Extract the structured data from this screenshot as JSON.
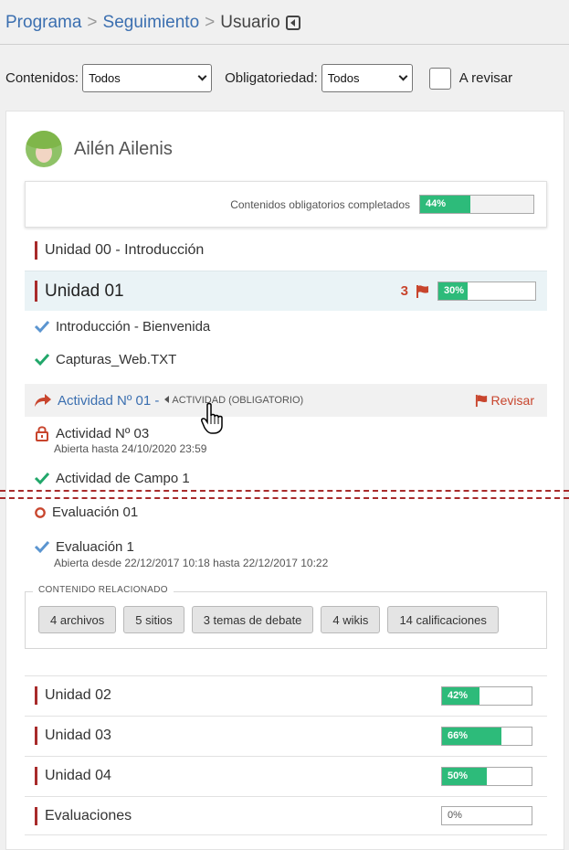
{
  "breadcrumb": {
    "item1": "Programa",
    "sep1": ">",
    "item2": "Seguimiento",
    "sep2": ">",
    "current": "Usuario"
  },
  "filters": {
    "contenidos_label": "Contenidos:",
    "contenidos_value": "Todos",
    "obligatoriedad_label": "Obligatoriedad:",
    "obligatoriedad_value": "Todos",
    "revisar_label": "A revisar"
  },
  "user": {
    "name": "Ailén Ailenis"
  },
  "summary": {
    "label": "Contenidos obligatorios completados",
    "percent_text": "44%",
    "percent": 44
  },
  "units": {
    "u00": {
      "title": "Unidad 00 - Introducción"
    },
    "u01": {
      "title": "Unidad 01",
      "flag_count": "3",
      "percent_text": "30%",
      "percent": 30
    }
  },
  "items": {
    "intro": "Introducción - Bienvenida",
    "capturas": "Capturas_Web.TXT",
    "actividad01": "Actividad Nº 01 -",
    "actividad01_tag": "ACTIVIDAD (OBLIGATORIO)",
    "revisar": "Revisar",
    "actividad03": "Actividad Nº 03",
    "actividad03_sub": "Abierta hasta 24/10/2020 23:59",
    "campo": "Actividad de Campo 1",
    "evaluacion01": "Evaluación 01",
    "evaluacion1": "Evaluación 1",
    "evaluacion1_sub": "Abierta desde 22/12/2017 10:18 hasta 22/12/2017 10:22"
  },
  "related": {
    "legend": "CONTENIDO RELACIONADO",
    "buttons": [
      "4 archivos",
      "5 sitios",
      "3 temas de debate",
      "4 wikis",
      "14 calificaciones"
    ]
  },
  "other_units": [
    {
      "title": "Unidad 02",
      "percent_text": "42%",
      "percent": 42
    },
    {
      "title": "Unidad 03",
      "percent_text": "66%",
      "percent": 66
    },
    {
      "title": "Unidad 04",
      "percent_text": "50%",
      "percent": 50
    },
    {
      "title": "Evaluaciones",
      "percent_text": "0%",
      "percent": 0
    }
  ],
  "colors": {
    "accent_blue": "#3b6fb0",
    "progress_green": "#2dbb7a",
    "flag_red": "#c8452d",
    "unit_marker": "#a82b2b"
  }
}
